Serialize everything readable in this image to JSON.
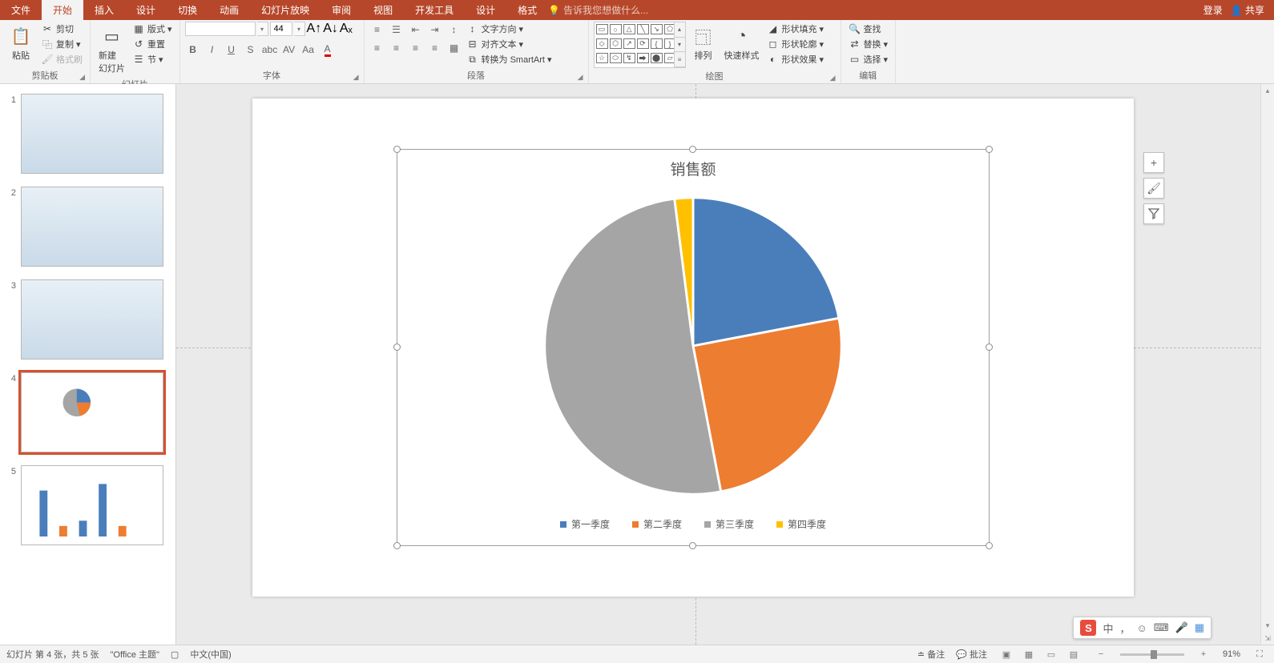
{
  "menu": {
    "tabs": [
      "文件",
      "开始",
      "插入",
      "设计",
      "切换",
      "动画",
      "幻灯片放映",
      "审阅",
      "视图",
      "开发工具",
      "设计",
      "格式"
    ],
    "active_index": 1,
    "tell_me": "告诉我您想做什么...",
    "login": "登录",
    "share": "共享"
  },
  "ribbon": {
    "clipboard": {
      "label": "剪贴板",
      "paste": "粘贴",
      "cut": "剪切",
      "copy": "复制",
      "format_painter": "格式刷"
    },
    "slides": {
      "label": "幻灯片",
      "new_slide": "新建\n幻灯片",
      "layout": "版式",
      "reset": "重置",
      "section": "节"
    },
    "font": {
      "label": "字体",
      "font_name": "",
      "font_size": "44"
    },
    "paragraph": {
      "label": "段落",
      "text_direction": "文字方向",
      "align_text": "对齐文本",
      "smartart": "转换为 SmartArt"
    },
    "drawing": {
      "label": "绘图",
      "arrange": "排列",
      "quick_styles": "快速样式",
      "shape_fill": "形状填充",
      "shape_outline": "形状轮廓",
      "shape_effects": "形状效果"
    },
    "editing": {
      "label": "编辑",
      "find": "查找",
      "replace": "替换",
      "select": "选择"
    }
  },
  "thumbnails": {
    "count": 5,
    "selected": 4
  },
  "chart_data": {
    "type": "pie",
    "title": "销售额",
    "categories": [
      "第一季度",
      "第二季度",
      "第三季度",
      "第四季度"
    ],
    "values": [
      22,
      25,
      51,
      2
    ],
    "colors": [
      "#4a7ebb",
      "#ed7d31",
      "#a5a5a5",
      "#ffc000"
    ]
  },
  "chart_tools": {
    "add": "+",
    "brush": "🖌",
    "filter": "▾"
  },
  "status": {
    "slide_info": "幻灯片 第 4 张，共 5 张",
    "theme": "\"Office 主题\"",
    "language": "中文(中国)",
    "notes": "备注",
    "comments": "批注",
    "zoom": "91%"
  },
  "ime": {
    "logo": "S",
    "mode": "中",
    "punct": "，",
    "emoji": "☺",
    "keyboard": "⌨",
    "mic": "🎤",
    "grid": "▦"
  }
}
